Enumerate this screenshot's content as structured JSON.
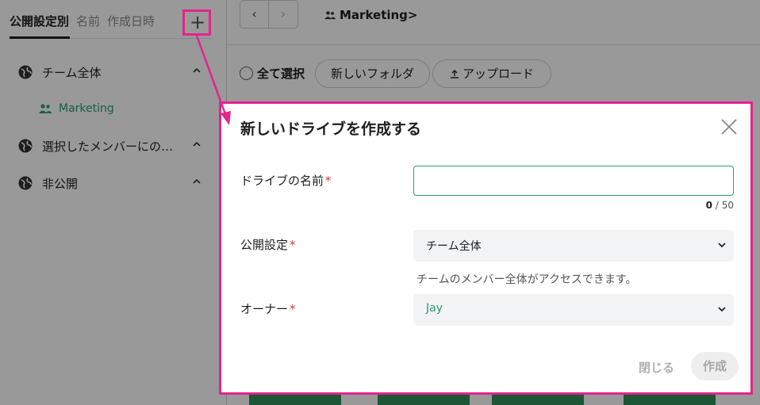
{
  "sidebar": {
    "sort_tabs": [
      "公開設定別",
      "名前",
      "作成日時"
    ],
    "add_label": "+",
    "tree": [
      {
        "label": "チーム全体",
        "children": [
          {
            "label": "Marketing"
          }
        ]
      },
      {
        "label": "選択したメンバーにの…"
      },
      {
        "label": "非公開"
      }
    ]
  },
  "toolbar": {
    "prev": "‹",
    "next": "›",
    "breadcrumb": "Marketing>",
    "select_all": "全て選択",
    "new_folder": "新しいフォルダ",
    "upload": "アップロード"
  },
  "modal": {
    "title": "新しいドライブを作成する",
    "name_label": "ドライブの名前",
    "required_mark": "*",
    "name_value": "",
    "counter_current": "0",
    "counter_max": "/ 50",
    "visibility_label": "公開設定",
    "visibility_value": "チーム全体",
    "visibility_help": "チームのメンバー全体がアクセスできます。",
    "owner_label": "オーナー",
    "owner_value": "Jay",
    "close_button": "閉じる",
    "create_button": "作成"
  },
  "colors": {
    "accent_green": "#26a069",
    "highlight_pink": "#e4238e",
    "required_red": "#d33a3a"
  }
}
